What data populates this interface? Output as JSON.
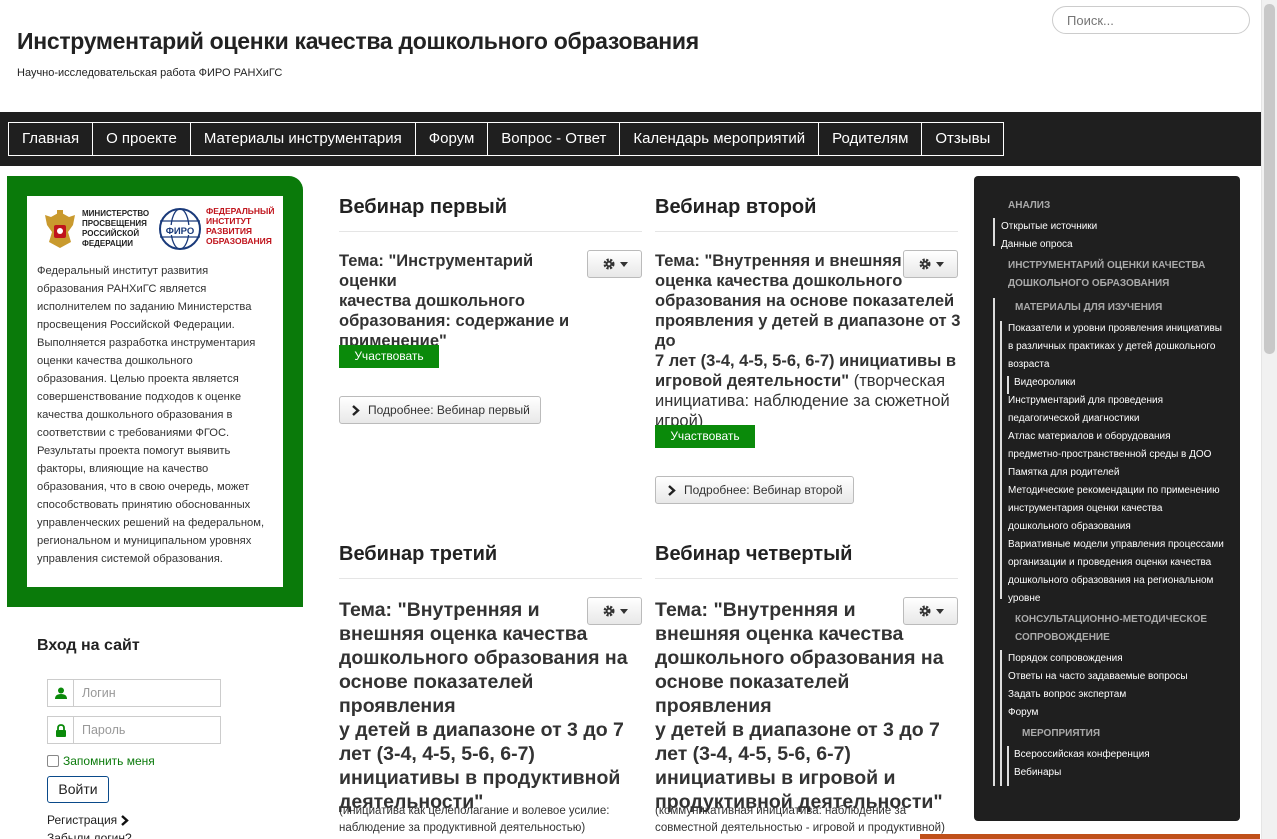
{
  "header": {
    "title": "Инструментарий оценки качества дошкольного образования",
    "subtitle": "Научно-исследовательская работа ФИРО РАНХиГС",
    "search_placeholder": "Поиск..."
  },
  "nav": [
    {
      "label": "Главная"
    },
    {
      "label": "О проекте"
    },
    {
      "label": "Материалы инструментария"
    },
    {
      "label": "Форум"
    },
    {
      "label": "Вопрос - Ответ"
    },
    {
      "label": "Календарь мероприятий"
    },
    {
      "label": "Родителям"
    },
    {
      "label": "Отзывы"
    }
  ],
  "info": {
    "ministry_logo_text": "МИНИСТЕРСТВО ПРОСВЕЩЕНИЯ РОССИЙСКОЙ ФЕДЕРАЦИИ",
    "firo_logo_text": "ФЕДЕРАЛЬНЫЙ ИНСТИТУТ РАЗВИТИЯ ОБРАЗОВАНИЯ",
    "firo_emblem_text": "ФИРО",
    "lines": [
      "Федеральный институт развития",
      "образования РАНХиГС является",
      "исполнителем по заданию Министерства",
      "просвещения Российской Федерации.",
      "Выполняется разработка инструментария",
      "оценки качества дошкольного",
      "образования. Целью проекта является",
      "совершенствование подходов к оценке",
      "качества дошкольного образования в",
      "соответствии с требованиями ФГОС.",
      "Результаты проекта помогут выявить",
      "факторы, влияющие на качество",
      "образования, что в свою очередь, может",
      "способствовать принятию обоснованных",
      "управленческих решений на федеральном,",
      "региональном и муниципальном уровнях",
      "управления системой образования."
    ]
  },
  "login": {
    "title": "Вход на сайт",
    "username_placeholder": "Логин",
    "password_placeholder": "Пароль",
    "remember_label": "Запомнить меня",
    "submit_label": "Войти",
    "register_label": "Регистрация",
    "forgot_label": "Забыли логин?"
  },
  "webinars": [
    {
      "title": "Вебинар первый",
      "topic_lines": [
        "Тема: \"Инструментарий оценки",
        "качества дошкольного",
        "образования: содержание и",
        "применение\""
      ],
      "participate": "Участвовать",
      "more": "Подробнее: Вебинар первый"
    },
    {
      "title": "Вебинар второй",
      "topic_lines": [
        "Тема: \"Внутренняя и внешняя",
        "оценка качества дошкольного",
        "образования на основе показателей",
        "проявления у детей в диапазоне от 3 до",
        "7 лет (3-4, 4-5, 5-6, 6-7) инициативы в",
        "игровой деятельности\""
      ],
      "topic_rest_lines": [
        " (творческая",
        "инициатива: наблюдение за сюжетной",
        "игрой)"
      ],
      "participate": "Участвовать",
      "more": "Подробнее: Вебинар второй"
    },
    {
      "title": "Вебинар третий",
      "topic_lines": [
        "Тема: \"Внутренняя и",
        "внешняя оценка качества",
        "дошкольного образования на",
        "основе показателей проявления",
        "у детей в диапазоне от 3 до 7",
        "лет (3-4, 4-5, 5-6, 6-7)",
        "инициативы в продуктивной",
        "деятельности\""
      ],
      "note_lines": [
        "(инициатива как целеполагание и волевое усилие:",
        "наблюдение за продуктивной деятельностью)"
      ]
    },
    {
      "title": "Вебинар четвертый",
      "topic_lines": [
        "Тема: \"Внутренняя и",
        "внешняя оценка качества",
        "дошкольного образования на",
        "основе показателей проявления",
        "у детей в диапазоне от 3 до 7",
        "лет (3-4, 4-5, 5-6, 6-7)",
        "инициативы в игровой и",
        "продуктивной деятельности\""
      ],
      "note_lines": [
        "(коммуникативная инициатива: наблюдение за",
        "совместной деятельностью - игровой и продуктивной)"
      ]
    }
  ],
  "menu": {
    "analysis": "АНАЛИЗ",
    "open_sources": "Открытые источники",
    "survey_data": "Данные опроса",
    "tool_section": [
      "ИНСТРУМЕНТАРИЙ ОЦЕНКИ КАЧЕСТВА",
      "ДОШКОЛЬНОГО ОБРАЗОВАНИЯ"
    ],
    "study_materials": "МАТЕРИАЛЫ ДЛЯ ИЗУЧЕНИЯ",
    "m1": [
      "Показатели и уровни проявления инициативы",
      "в различных практиках у детей дошкольного",
      "возраста"
    ],
    "videos": "Видеоролики",
    "m2": [
      "Инструментарий для проведения",
      "педагогической диагностики"
    ],
    "m3": [
      "Атлас материалов и оборудования",
      "предметно-пространственной среды в ДОО"
    ],
    "m4": "Памятка для родителей",
    "m5": [
      "Методические рекомендации по применению",
      "инструментария оценки качества",
      "дошкольного образования"
    ],
    "m6": [
      "Вариативные модели управления процессами",
      "организации и проведения оценки качества",
      "дошкольного образования на региональном",
      "уровне"
    ],
    "consult": [
      "КОНСУЛЬТАЦИОННО-МЕТОДИЧЕСКОЕ",
      "СОПРОВОЖДЕНИЕ"
    ],
    "c1": "Порядок сопровождения",
    "c2": "Ответы на часто задаваемые вопросы",
    "c3": "Задать вопрос экспертам",
    "c4": "Форум",
    "events": "МЕРОПРИЯТИЯ",
    "e1": "Всероссийская конференция",
    "e2": "Вебинары"
  },
  "colors": {
    "accent_green": "#0a7a0a",
    "dark": "#1f1f1f",
    "firo_red": "#c0141c"
  }
}
